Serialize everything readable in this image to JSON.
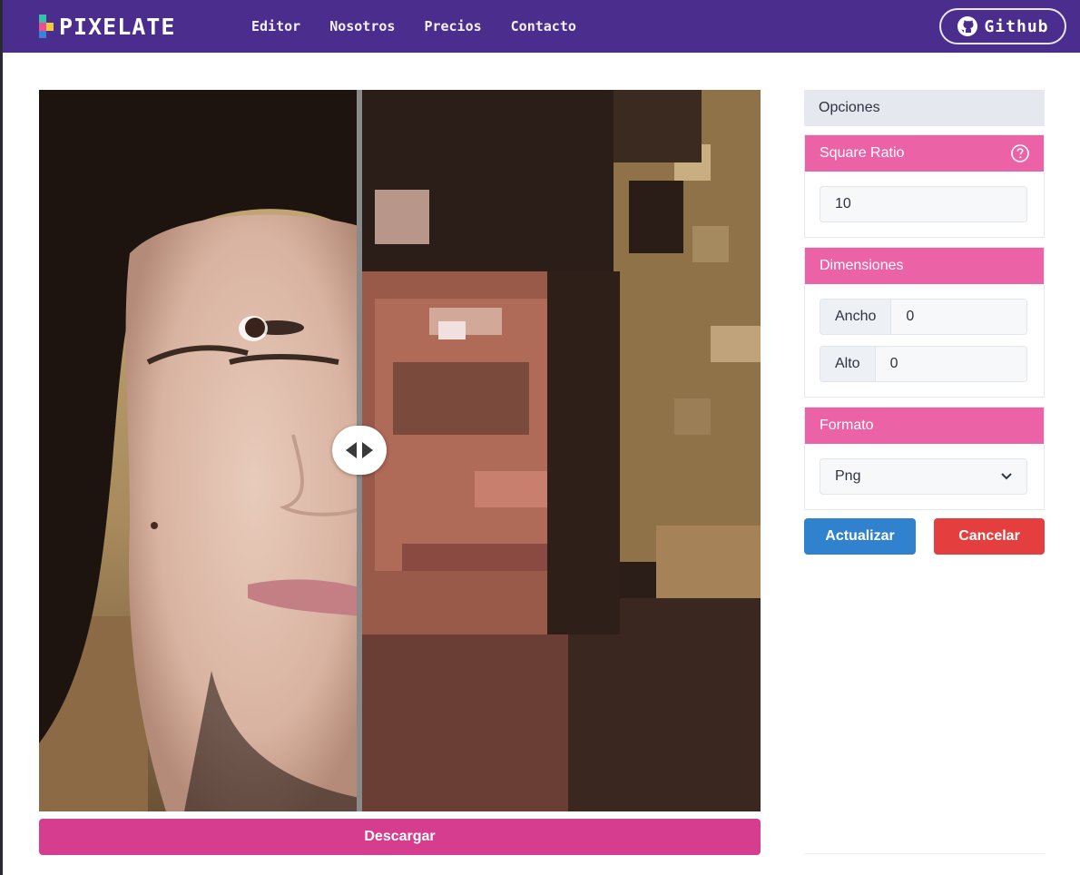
{
  "navbar": {
    "brand": "PIXELATE",
    "links": [
      "Editor",
      "Nosotros",
      "Precios",
      "Contacto"
    ],
    "github_label": "Github",
    "background": "#4a2d8c"
  },
  "editor": {
    "download_label": "Descargar",
    "handle_icon": "left-right-arrows-icon"
  },
  "options": {
    "header": "Opciones",
    "square_ratio": {
      "title": "Square Ratio",
      "help_icon": "question-circle-icon",
      "value": "10"
    },
    "dimensions": {
      "title": "Dimensiones",
      "width_label": "Ancho",
      "width_value": "0",
      "height_label": "Alto",
      "height_value": "0"
    },
    "format": {
      "title": "Formato",
      "selected": "Png"
    },
    "update_label": "Actualizar",
    "cancel_label": "Cancelar"
  },
  "colors": {
    "accent_pink": "#ec62a7",
    "download_pink": "#d63d8f",
    "update_blue": "#3182ce",
    "cancel_red": "#e53e3e"
  }
}
